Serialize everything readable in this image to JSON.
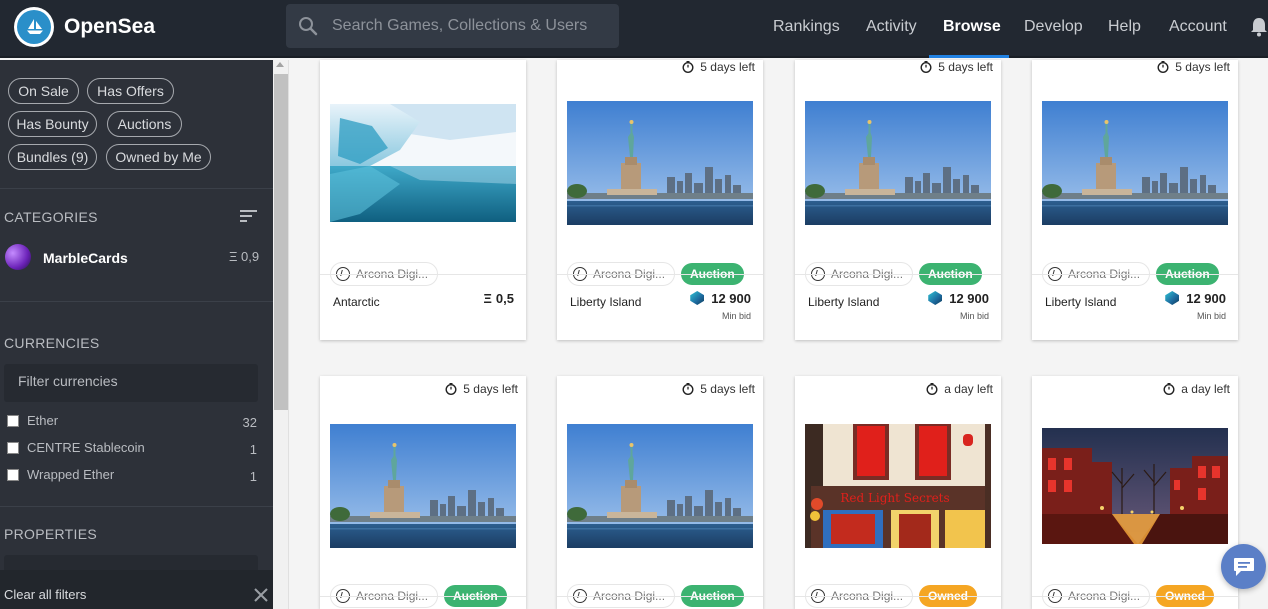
{
  "brand": "OpenSea",
  "search": {
    "placeholder": "Search Games, Collections & Users"
  },
  "nav": [
    "Rankings",
    "Activity",
    "Browse",
    "Develop",
    "Help",
    "Account"
  ],
  "active_nav": "Browse",
  "filters": {
    "pills": [
      "On Sale",
      "Has Offers",
      "Has Bounty",
      "Auctions",
      "Bundles (9)",
      "Owned by Me"
    ]
  },
  "categories": {
    "title": "CATEGORIES",
    "items": [
      {
        "name": "MarbleCards",
        "price": "Ξ 0,9"
      }
    ]
  },
  "currencies": {
    "title": "CURRENCIES",
    "placeholder": "Filter currencies",
    "items": [
      {
        "label": "Ether",
        "count": "32"
      },
      {
        "label": "CENTRE Stablecoin",
        "count": "1"
      },
      {
        "label": "Wrapped Ether",
        "count": "1"
      }
    ]
  },
  "properties": {
    "title": "PROPERTIES"
  },
  "clear_label": "Clear all filters",
  "colors": {
    "auction": "#3cb371",
    "owned": "#f5a623",
    "accent": "#2081e2"
  },
  "cards": [
    {
      "timer": "",
      "art": "iceberg",
      "owner": "Arcona Digi...",
      "badge": "",
      "name": "Antarctic",
      "price_symbol": "Ξ",
      "price": "0,5",
      "min_bid": ""
    },
    {
      "timer": "5 days left",
      "art": "liberty",
      "owner": "Arcona Digi...",
      "badge": "Auction",
      "name": "Liberty Island",
      "price_symbol": "",
      "price": "12 900",
      "min_bid": "Min bid"
    },
    {
      "timer": "5 days left",
      "art": "liberty",
      "owner": "Arcona Digi...",
      "badge": "Auction",
      "name": "Liberty Island",
      "price_symbol": "",
      "price": "12 900",
      "min_bid": "Min bid"
    },
    {
      "timer": "5 days left",
      "art": "liberty",
      "owner": "Arcona Digi...",
      "badge": "Auction",
      "name": "Liberty Island",
      "price_symbol": "",
      "price": "12 900",
      "min_bid": "Min bid"
    },
    {
      "timer": "5 days left",
      "art": "liberty",
      "owner": "Arcona Digi...",
      "badge": "Auction"
    },
    {
      "timer": "5 days left",
      "art": "liberty",
      "owner": "Arcona Digi...",
      "badge": "Auction"
    },
    {
      "timer": "a day left",
      "art": "redlight-shop",
      "sign": "Red Light Secrets",
      "owner": "Arcona Digi...",
      "badge": "Owned"
    },
    {
      "timer": "a day left",
      "art": "canal",
      "owner": "Arcona Digi...",
      "badge": "Owned"
    }
  ]
}
